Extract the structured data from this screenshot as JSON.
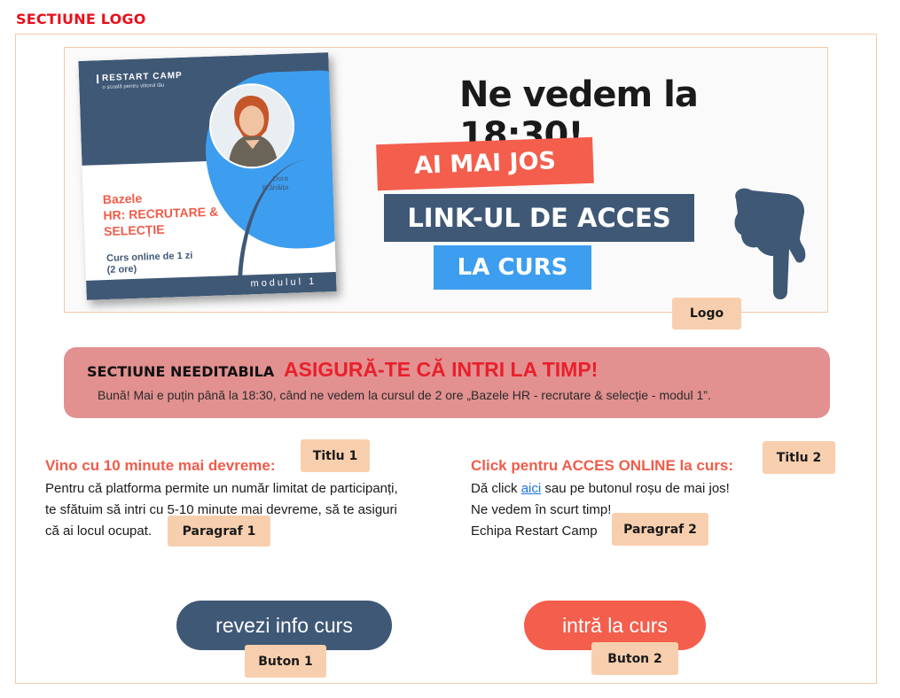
{
  "section_title": "SECTIUNE LOGO",
  "logo": {
    "card": {
      "brand": "RESTART CAMP",
      "brand_sub": "o școală pentru viitorul tău",
      "heading_line1": "Bazele",
      "heading_line2": "HR: RECRUTARE &",
      "heading_line3": "SELECȚIE",
      "sub_line1": "Curs online de 1 zi",
      "sub_line2": "(2 ore)",
      "person_line1": "Dora",
      "person_line2": "Brăhăița",
      "module": "modulul 1"
    },
    "headline": "Ne vedem la 18:30!",
    "banner_1": "AI MAI JOS",
    "banner_2": "LINK-UL DE ACCES",
    "banner_3": "LA CURS",
    "label": "Logo",
    "colors": {
      "coral": "#f45e4d",
      "navy": "#3f5876",
      "blue": "#3d9ef0"
    }
  },
  "non_editable": {
    "label": "SECTIUNE NEEDITABILA",
    "title": "ASIGURĂ-TE CĂ INTRI LA TIMP!",
    "text": "Bună! Mai e puțin până la 18:30, când ne vedem la cursul de 2 ore „Bazele HR - recrutare & selecție - modul 1”."
  },
  "left_column": {
    "title": "Vino cu 10 minute mai devreme:",
    "title_label": "Titlu 1",
    "lines": [
      "Pentru că platforma permite un număr limitat de participanți,",
      "te sfătuim să intri cu 5-10 minute mai devreme, să te asiguri",
      "că ai locul ocupat."
    ],
    "paragraph_label": "Paragraf 1"
  },
  "right_column": {
    "title": "Click pentru ACCES ONLINE la curs:",
    "title_label": "Titlu 2",
    "line1_before": "Dă click ",
    "line1_link": "aici",
    "line1_after": " sau pe butonul roșu de mai jos!",
    "line2": "Ne vedem în scurt timp!",
    "line3": "Echipa Restart Camp",
    "paragraph_label": "Paragraf 2"
  },
  "buttons": {
    "info": "revezi info curs",
    "info_label": "Buton 1",
    "enter": "intră la curs",
    "enter_label": "Buton 2"
  }
}
